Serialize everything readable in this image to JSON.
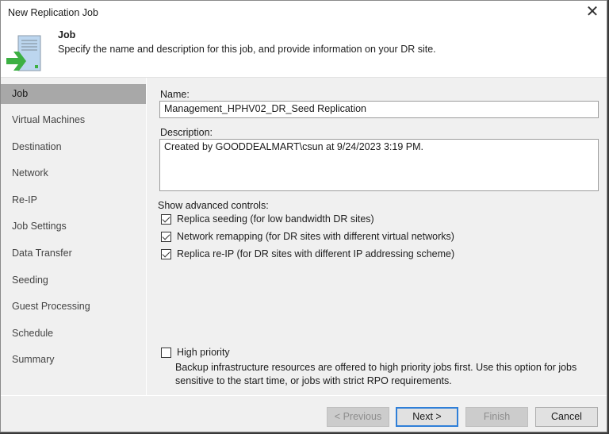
{
  "window": {
    "title": "New Replication Job",
    "close_icon": "close-icon"
  },
  "header": {
    "icon": "replication-job-icon",
    "title": "Job",
    "description": "Specify the name and description for this job, and provide information on your DR site."
  },
  "sidebar": {
    "items": [
      {
        "label": "Job",
        "active": true
      },
      {
        "label": "Virtual Machines",
        "active": false
      },
      {
        "label": "Destination",
        "active": false
      },
      {
        "label": "Network",
        "active": false
      },
      {
        "label": "Re-IP",
        "active": false
      },
      {
        "label": "Job Settings",
        "active": false
      },
      {
        "label": "Data Transfer",
        "active": false
      },
      {
        "label": "Seeding",
        "active": false
      },
      {
        "label": "Guest Processing",
        "active": false
      },
      {
        "label": "Schedule",
        "active": false
      },
      {
        "label": "Summary",
        "active": false
      }
    ]
  },
  "form": {
    "name_label": "Name:",
    "name_value": "Management_HPHV02_DR_Seed Replication",
    "description_label": "Description:",
    "description_value": "Created by GOODDEALMART\\csun at 9/24/2023 3:19 PM.",
    "advanced_label": "Show advanced controls:",
    "advanced_options": [
      {
        "label": "Replica seeding (for low bandwidth DR sites)",
        "checked": true
      },
      {
        "label": "Network remapping (for DR sites with different virtual networks)",
        "checked": true
      },
      {
        "label": "Replica re-IP (for DR sites with different IP addressing scheme)",
        "checked": true
      }
    ],
    "high_priority": {
      "label": "High priority",
      "checked": false,
      "note": "Backup infrastructure resources are offered to high priority jobs first. Use this option for jobs sensitive to the start time, or jobs with strict RPO requirements."
    }
  },
  "footer": {
    "previous_label": "< Previous",
    "next_label": "Next >",
    "finish_label": "Finish",
    "cancel_label": "Cancel"
  },
  "colors": {
    "accent": "#2f7fd8",
    "icon_green": "#3cb043",
    "icon_blue": "#bcd6ef",
    "active_item_bg": "#a8a8a8"
  }
}
